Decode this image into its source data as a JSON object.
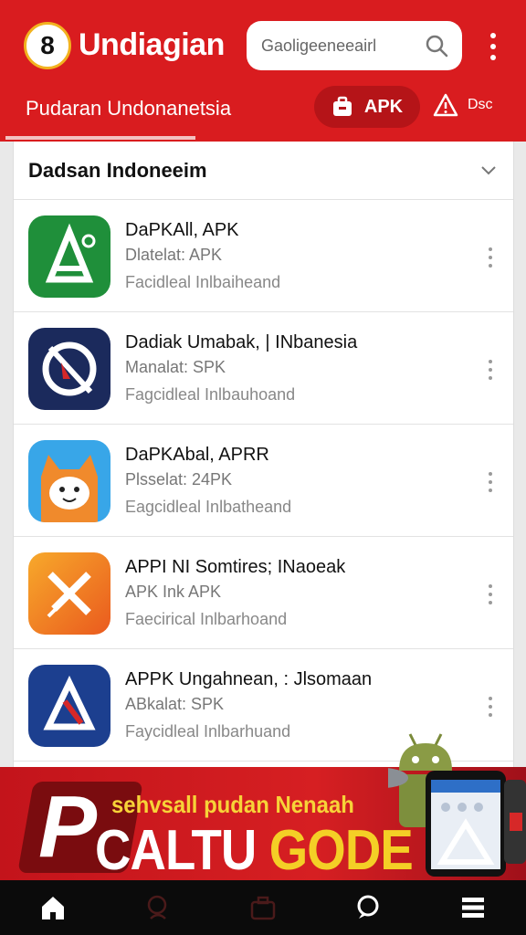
{
  "header": {
    "logo_text": "8",
    "title": "Undiagian",
    "search_placeholder": "Gaoligeeneeairl",
    "tabs": [
      {
        "label": "Pudaran Undonanetsia"
      },
      {
        "label": "APK"
      },
      {
        "label": "Dsc"
      }
    ]
  },
  "section": {
    "title": "Dadsan Indoneeim"
  },
  "apps": [
    {
      "name": "DaPKAll, APK",
      "line1": "Dlatelat: APK",
      "line2": "Facidleal Inlbaiheand",
      "icon": "green-a-icon"
    },
    {
      "name": "Dadiak Umabak, | INbanesia",
      "line1": "Manalat: SPK",
      "line2": "Fagcidleal Inlbauhoand",
      "icon": "navy-circle-icon"
    },
    {
      "name": "DaPKAbal, APRR",
      "line1": "Plsselat: 24PK",
      "line2": "Eagcidleal Inlbatheand",
      "icon": "robot-cat-icon"
    },
    {
      "name": "APPI NI Somtires; INaoeak",
      "line1": "APK Ink APK",
      "line2": "Faecirical Inlbarhoand",
      "icon": "orange-x-icon"
    },
    {
      "name": "APPK Ungahnean, : Jlsomaan",
      "line1": "ABkalat: SPK",
      "line2": "Faycidleal Inlbarhuand",
      "icon": "blue-a-icon"
    }
  ],
  "banner": {
    "letter": "P",
    "tagline": "sehvsall pudan Nenaah",
    "headline_white": "CALTU",
    "headline_yellow": "GODE"
  },
  "colors": {
    "brand_red": "#d91c1f",
    "dark_red": "#b51418",
    "nav_bg": "#0b0b0b",
    "banner_yellow": "#f4cf26"
  }
}
